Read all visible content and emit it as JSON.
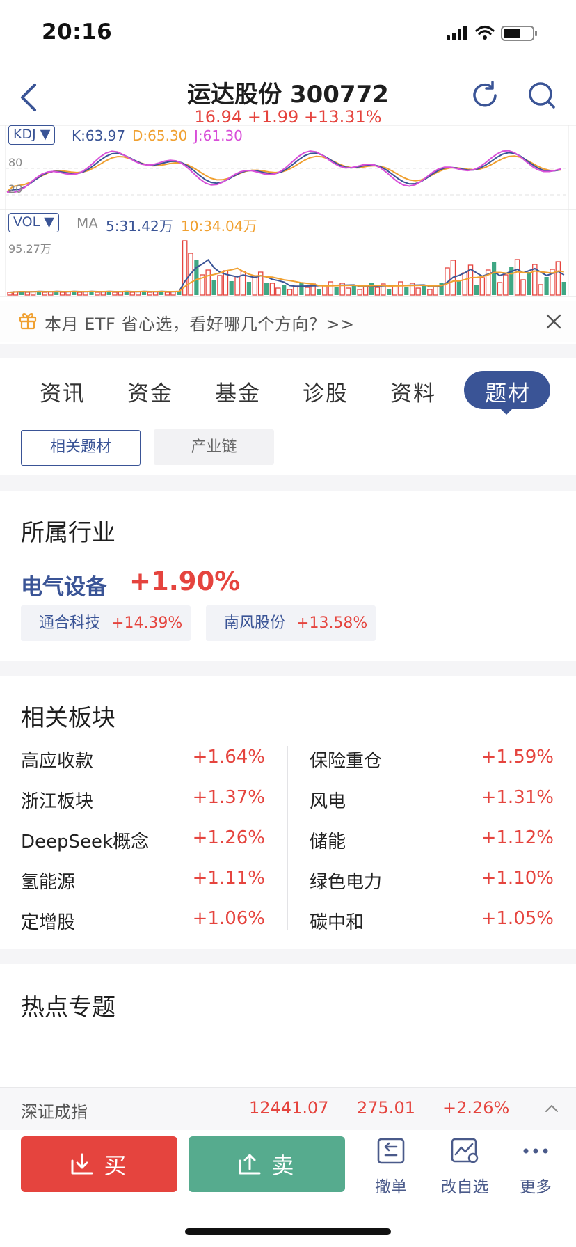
{
  "status_bar": {
    "time": "20:16"
  },
  "header": {
    "title": "运达股份 300772",
    "quote": "16.94 +1.99 +13.31%"
  },
  "chart": {
    "kdj": {
      "selector": "KDJ ▼",
      "k": "K:63.97",
      "d": "D:65.30",
      "j": "J:61.30",
      "level_80": "80",
      "level_20": "20"
    },
    "vol": {
      "selector": "VOL ▼",
      "ma_label": "MA",
      "ma5": "5:31.42万",
      "ma10": "10:34.04万",
      "max": "95.27万"
    },
    "colors": {
      "k": "#3a5496",
      "d": "#f0a030",
      "j": "#d84fd8",
      "up": "#e5443e",
      "down": "#3fa784"
    }
  },
  "banner": {
    "text": "本月 ETF 省心选，看好哪几个方向？>>"
  },
  "tabs": [
    "资讯",
    "资金",
    "基金",
    "诊股",
    "资料",
    "题材"
  ],
  "active_tab": "题材",
  "sub_tabs": [
    "相关题材",
    "产业链"
  ],
  "industry": {
    "title": "所属行业",
    "name": "电气设备",
    "change": "+1.90%",
    "stocks": [
      {
        "name": "通合科技",
        "change": "+14.39%"
      },
      {
        "name": "南风股份",
        "change": "+13.58%"
      }
    ]
  },
  "sectors": {
    "title": "相关板块",
    "left": [
      {
        "name": "高应收款",
        "change": "+1.64%"
      },
      {
        "name": "浙江板块",
        "change": "+1.37%"
      },
      {
        "name": "DeepSeek概念",
        "change": "+1.26%"
      },
      {
        "name": "氢能源",
        "change": "+1.11%"
      },
      {
        "name": "定增股",
        "change": "+1.06%"
      }
    ],
    "right": [
      {
        "name": "保险重仓",
        "change": "+1.59%"
      },
      {
        "name": "风电",
        "change": "+1.31%"
      },
      {
        "name": "储能",
        "change": "+1.12%"
      },
      {
        "name": "绿色电力",
        "change": "+1.10%"
      },
      {
        "name": "碳中和",
        "change": "+1.05%"
      }
    ]
  },
  "hot_topics": {
    "title": "热点专题"
  },
  "index_bar": {
    "name": "深证成指",
    "value": "12441.07",
    "change": "275.01",
    "pct": "+2.26%"
  },
  "bottom_bar": {
    "buy": "买",
    "sell": "卖",
    "cancel": "撤单",
    "watchlist": "改自选",
    "more": "更多"
  }
}
